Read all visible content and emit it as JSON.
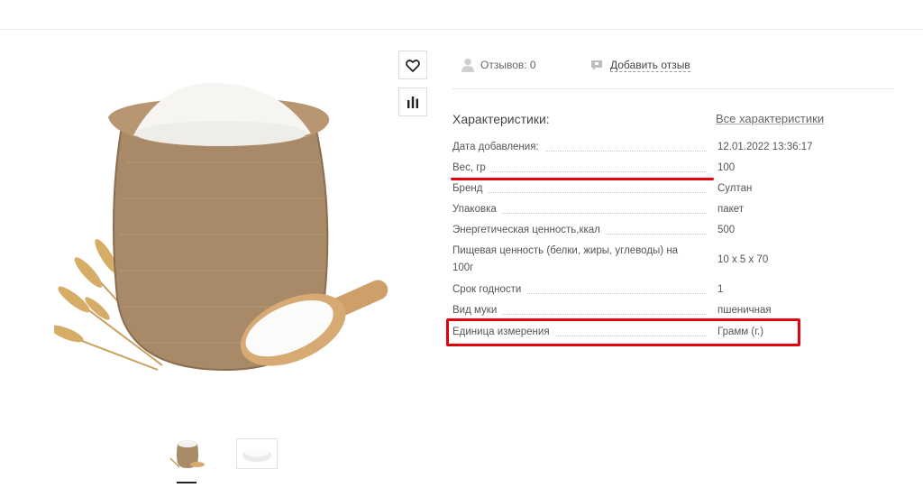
{
  "reviews": {
    "count_label": "Отзывов: 0",
    "add_label": "Добавить отзыв"
  },
  "characteristics": {
    "title": "Характеристики:",
    "all_link": "Все характеристики",
    "rows": [
      {
        "name": "Дата добавления:",
        "value": "12.01.2022 13:36:17"
      },
      {
        "name": "Вес, гр",
        "value": "100"
      },
      {
        "name": "Бренд",
        "value": "Султан"
      },
      {
        "name": "Упаковка",
        "value": "пакет"
      },
      {
        "name": "Энергетическая ценность,ккал",
        "value": "500"
      },
      {
        "name_line1": "Пищевая ценность (белки, жиры, углеводы) на",
        "name_line2": "100г",
        "value": "10 x 5 x 70"
      },
      {
        "name": "Срок годности",
        "value": "1"
      },
      {
        "name": "Вид муки",
        "value": "пшеничная"
      },
      {
        "name": "Единица измерения",
        "value": "Грамм (г.)"
      }
    ]
  },
  "icons": {
    "favorite": "heart-icon",
    "compare": "bar-chart-icon",
    "user": "user-icon",
    "comment": "comment-icon"
  },
  "colors": {
    "annotation_red": "#e4000f",
    "text": "#555555",
    "divider": "#e6e6e6"
  }
}
